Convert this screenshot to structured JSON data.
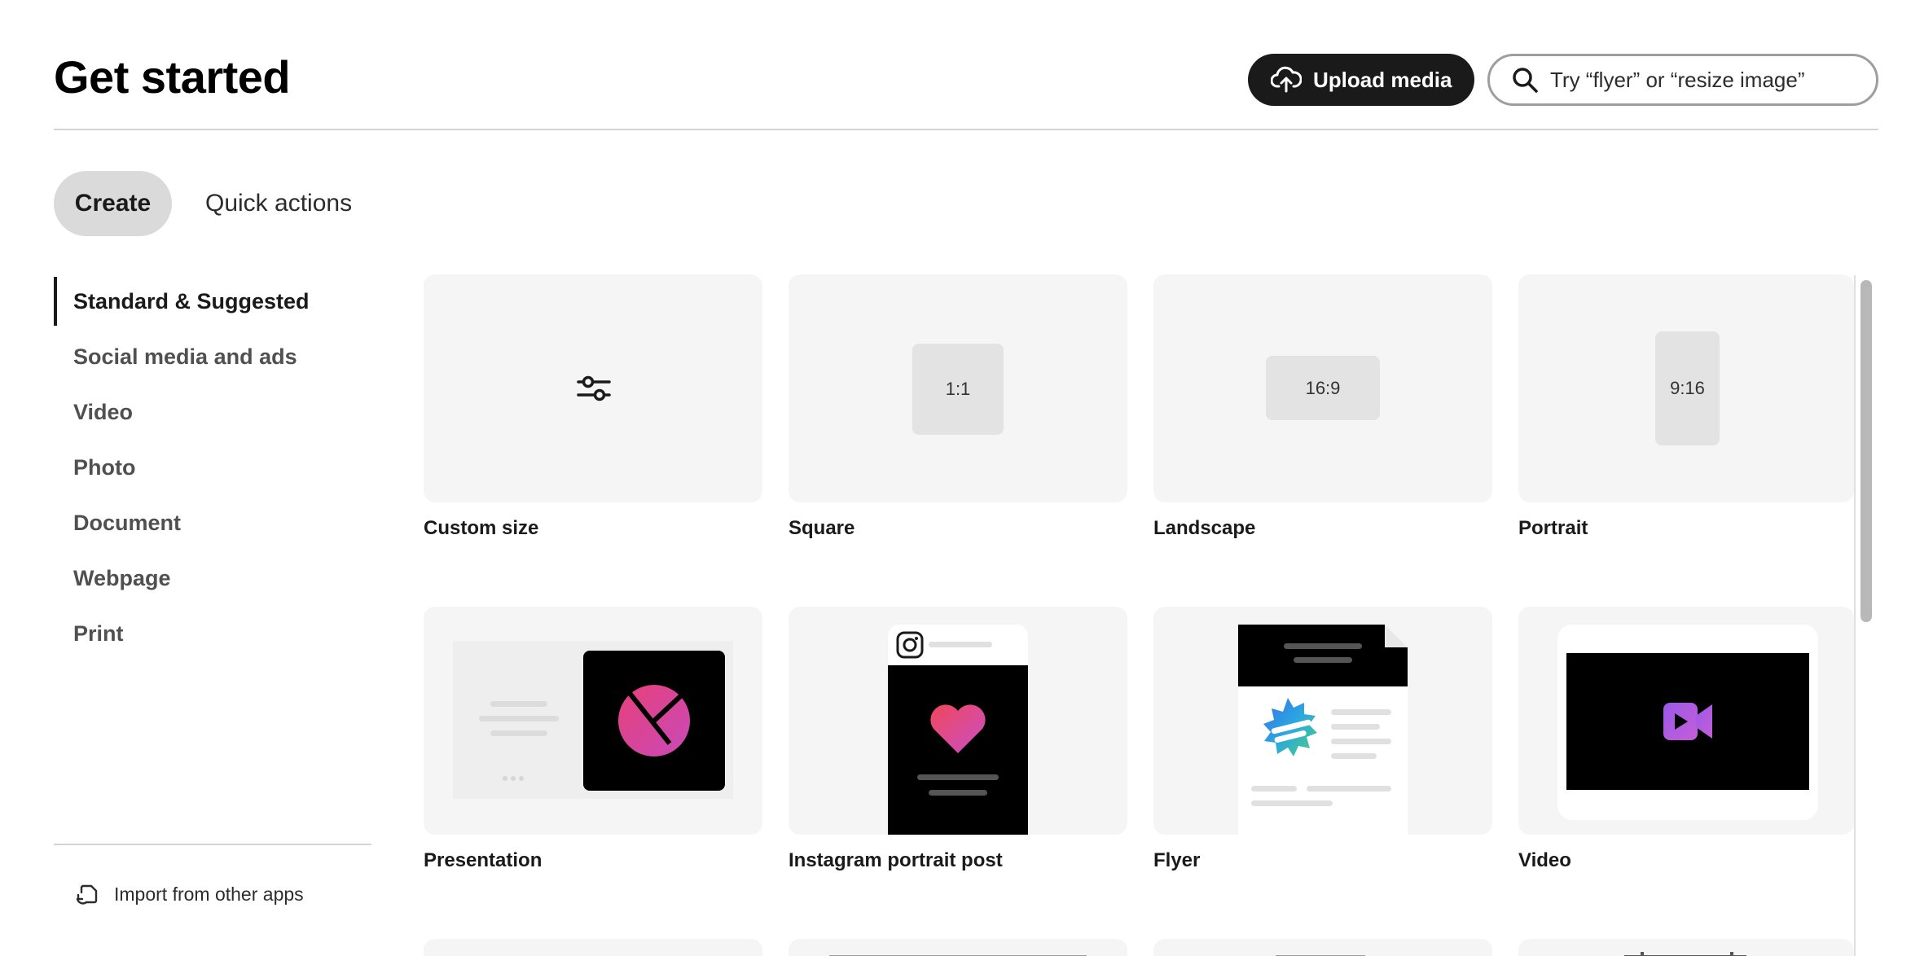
{
  "header": {
    "title": "Get started",
    "upload_label": "Upload media",
    "search_placeholder": "Try “flyer” or “resize image”"
  },
  "tabs": [
    {
      "label": "Create",
      "active": true
    },
    {
      "label": "Quick actions",
      "active": false
    }
  ],
  "sidebar": {
    "items": [
      {
        "label": "Standard & Suggested",
        "active": true
      },
      {
        "label": "Social media and ads"
      },
      {
        "label": "Video"
      },
      {
        "label": "Photo"
      },
      {
        "label": "Document"
      },
      {
        "label": "Webpage"
      },
      {
        "label": "Print"
      }
    ],
    "import_label": "Import from other apps"
  },
  "cards": [
    {
      "label": "Custom size",
      "icon": "sliders-icon"
    },
    {
      "label": "Square",
      "ratio": "1:1"
    },
    {
      "label": "Landscape",
      "ratio": "16:9"
    },
    {
      "label": "Portrait",
      "ratio": "9:16"
    },
    {
      "label": "Presentation"
    },
    {
      "label": "Instagram portrait post"
    },
    {
      "label": "Flyer"
    },
    {
      "label": "Video"
    }
  ],
  "colors": {
    "accent_dark": "#1a1a1a",
    "tab_active_bg": "#dadada",
    "card_bg": "#f5f5f5",
    "gradient_pink": "#e8407a",
    "gradient_purple": "#9b59e8"
  }
}
